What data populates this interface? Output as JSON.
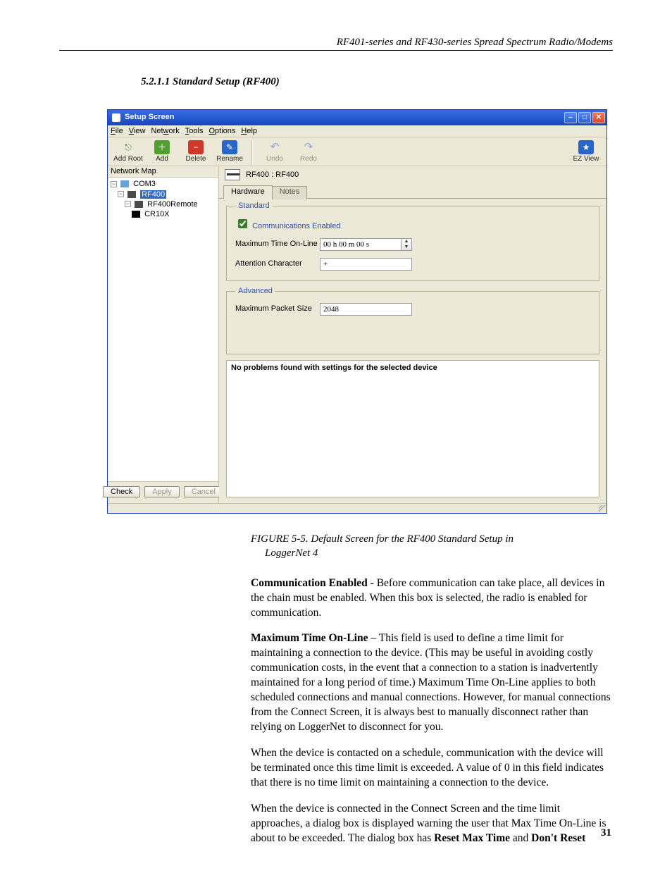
{
  "running_head": "RF401-series and RF430-series Spread Spectrum Radio/Modems",
  "section_heading": "5.2.1.1  Standard Setup (RF400)",
  "figure_caption": {
    "line1": "FIGURE 5-5.  Default Screen for the RF400 Standard Setup in",
    "line2": "LoggerNet 4"
  },
  "window": {
    "title": "Setup Screen",
    "menus": {
      "file": "File",
      "view": "View",
      "network": "Network",
      "tools": "Tools",
      "options": "Options",
      "help": "Help"
    },
    "toolbar": {
      "add_root": "Add Root",
      "add": "Add",
      "delete": "Delete",
      "rename": "Rename",
      "undo": "Undo",
      "redo": "Redo",
      "ezview": "EZ View"
    },
    "tree_label": "Network Map",
    "tree": {
      "root": "COM3",
      "n1": "RF400",
      "n2": "RF400Remote",
      "n3": "CR10X"
    },
    "buttons": {
      "check": "Check",
      "apply": "Apply",
      "cancel": "Cancel"
    },
    "device_title": "RF400 : RF400",
    "tabs": {
      "hardware": "Hardware",
      "notes": "Notes"
    },
    "group_standard": "Standard",
    "group_advanced": "Advanced",
    "comm_enabled": "Communications Enabled",
    "max_time_label": "Maximum Time On-Line",
    "max_time_value": "00 h 00 m 00 s",
    "attn_label": "Attention Character",
    "attn_value": "+",
    "max_packet_label": "Maximum Packet Size",
    "max_packet_value": "2048",
    "status_msg": "No problems found with settings for the selected device"
  },
  "paras": {
    "p1a": "Communication Enabled",
    "p1b": " - Before communication can take place, all devices in the chain must be enabled.  When this box is selected, the radio is enabled for communication.",
    "p2a": "Maximum Time On-Line",
    "p2b": " – This field is used to define a time limit for maintaining a connection to the device. (This may be useful in avoiding costly communication costs, in the event that a connection to a station is inadvertently maintained for a long period of time.) Maximum Time On-Line applies to both scheduled connections and manual connections. However, for manual connections from the Connect Screen, it is always best to manually disconnect rather than relying on LoggerNet to disconnect for you.",
    "p3": "When the device is contacted on a schedule, communication with the device will be terminated once this time limit is exceeded. A value of 0 in this field indicates that there is no time limit on maintaining a connection to the device.",
    "p4a": "When the device is connected in the Connect Screen and the time limit approaches, a dialog box is displayed warning the user that Max Time On-Line is about to be exceeded. The dialog box has ",
    "p4b": "Reset Max Time",
    "p4c": " and ",
    "p4d": "Don't Reset"
  },
  "page_number": "31"
}
